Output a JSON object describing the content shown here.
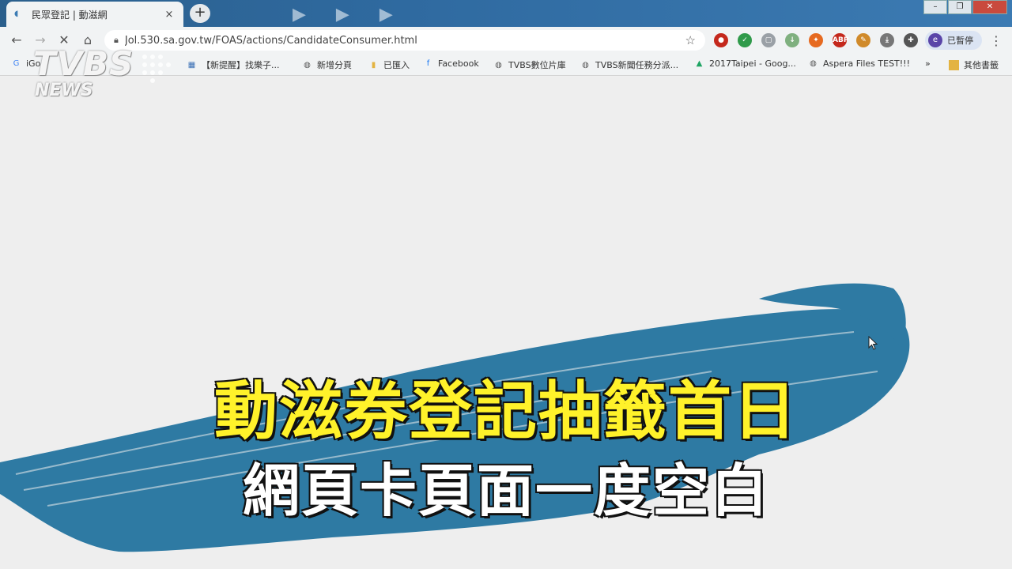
{
  "tab": {
    "title": "民眾登記 | 動滋網",
    "close": "×",
    "new_tab": "+"
  },
  "window_controls": {
    "minimize": "–",
    "restore": "❐",
    "close": "✕"
  },
  "toolbar": {
    "back": "←",
    "forward": "→",
    "stop": "✕",
    "home": "⌂",
    "url": "Jol.530.sa.gov.tw/FOAS/actions/CandidateConsumer.html",
    "star": "☆",
    "profile_initial": "e",
    "profile_label": "已暫停",
    "menu": "⋮"
  },
  "extensions": [
    {
      "name": "ublock-icon",
      "label": "●",
      "color": "#c4281c"
    },
    {
      "name": "shield-icon",
      "label": "✓",
      "color": "#2f9a4a"
    },
    {
      "name": "pages-icon",
      "label": "▢",
      "color": "#9aa0a6"
    },
    {
      "name": "download-arrow-icon",
      "label": "↓",
      "color": "#7fb07f"
    },
    {
      "name": "fox-icon",
      "label": "✦",
      "color": "#e66a20"
    },
    {
      "name": "abp-icon",
      "label": "ABP",
      "color": "#c4281c"
    },
    {
      "name": "edit-icon",
      "label": "✎",
      "color": "#d08a2a"
    },
    {
      "name": "save-icon",
      "label": "⤓",
      "color": "#777777"
    },
    {
      "name": "puzzle-icon",
      "label": "✚",
      "color": "#555555"
    }
  ],
  "bookmarks": [
    {
      "label": "iGo",
      "icon": "G",
      "icon_color": "#4285f4"
    },
    {
      "label": "【新提醒】找樂子...",
      "icon": "▦",
      "icon_color": "#3a6fb5"
    },
    {
      "label": "新增分頁",
      "icon": "◍",
      "icon_color": "#555555"
    },
    {
      "label": "已匯入",
      "icon": "▮",
      "icon_color": "#e3b341"
    },
    {
      "label": "Facebook",
      "icon": "f",
      "icon_color": "#1877f2"
    },
    {
      "label": "TVBS數位片庫",
      "icon": "◍",
      "icon_color": "#555555"
    },
    {
      "label": "TVBS新聞任務分派...",
      "icon": "◍",
      "icon_color": "#555555"
    },
    {
      "label": "2017Taipei - Goog...",
      "icon": "▲",
      "icon_color": "#1fa463"
    },
    {
      "label": "Aspera Files TEST!!!",
      "icon": "◍",
      "icon_color": "#555555"
    }
  ],
  "bookmarks_more": "»",
  "other_bookmarks": "其他書籤",
  "logo": {
    "brand": "TVBS",
    "sub": "NEWS"
  },
  "caption": {
    "line1": "動滋券登記抽籤首日",
    "line2": "網頁卡頁面一度空白"
  },
  "colors": {
    "brush": "#2e7aa3",
    "caption_yellow": "#fff22a",
    "tabstrip": "#2f6aa0"
  }
}
